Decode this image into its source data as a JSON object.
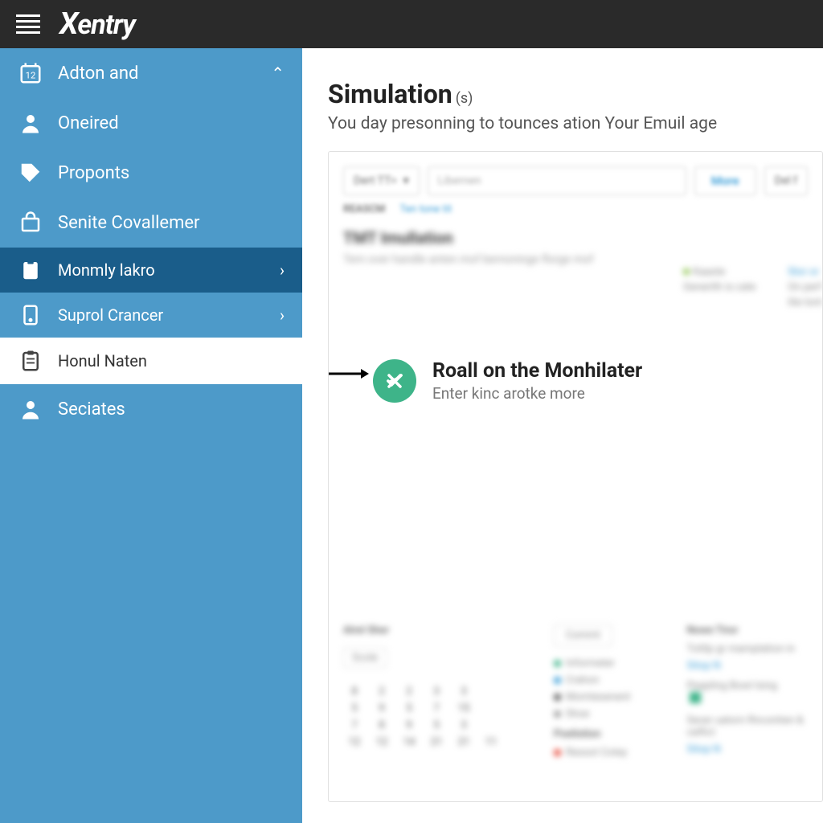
{
  "header": {
    "brand": "Xentry"
  },
  "sidebar": {
    "items": [
      {
        "label": "Adton and",
        "icon": "calendar",
        "chevron": "up"
      },
      {
        "label": "Oneired",
        "icon": "person"
      },
      {
        "label": "Proponts",
        "icon": "tag"
      },
      {
        "label": "Senite Covallemer",
        "icon": "bag"
      },
      {
        "label": "Monmly lakro",
        "icon": "clipboard",
        "chevron": "right",
        "variant": "dark"
      },
      {
        "label": "Suprol Crancer",
        "icon": "device",
        "chevron": "right"
      },
      {
        "label": "Honul Naten",
        "icon": "clipboard-list",
        "variant": "active"
      },
      {
        "label": "Seciates",
        "icon": "person"
      }
    ]
  },
  "main": {
    "title": "Simulation",
    "title_suffix": "(s)",
    "subtitle": "You day presonning to tounces ation Your Emuil age",
    "toolbar": {
      "dropdown_label": "Dert TT>",
      "search_placeholder": "Libernen",
      "more_label": "More",
      "extra_label": "Del f"
    },
    "tabs": {
      "t1": "REASCM",
      "t2": "Ten tone tit"
    },
    "blurred": {
      "title": "TMT Imullation",
      "text": "Tern over handle anten mof bernoninge florge mof",
      "right_col1_a": "Kaaste",
      "right_col1_b": "Generith is cate",
      "right_col2_a": "Stor or",
      "right_col2_b": "On perf",
      "right_col2_c": "lite lont"
    },
    "callout": {
      "title": "Roall on the Monhilater",
      "sub": "Enter kinc arotke more"
    },
    "bottom": {
      "col1_hdr": "Alrel Sher",
      "cal_hdr": "Scole",
      "cal": [
        "8",
        "2",
        "2",
        "3",
        "3",
        "",
        "",
        "5",
        "9",
        "5",
        "7",
        "15",
        "",
        "",
        "7",
        "8",
        "9",
        "5",
        "3",
        "",
        "",
        "12",
        "12",
        "14",
        "21",
        "21",
        "11",
        ""
      ],
      "col2_btn": "Commt",
      "leg": [
        "Informeter",
        "Crahon",
        "Momtesenent",
        "Shoe"
      ],
      "col2_hdr2": "Poelistion",
      "col2_item": "Ressot Cotey",
      "col3_hdr": "Nowe Tiror",
      "col3_a": "Tottlp gr mamplation in",
      "col3_link1": "Sitop N",
      "col3_b": "Peapling Bowl lsing",
      "col3_c": "Sever uatorn Rncontien & celfict",
      "col3_link2": "Sitop N"
    }
  }
}
